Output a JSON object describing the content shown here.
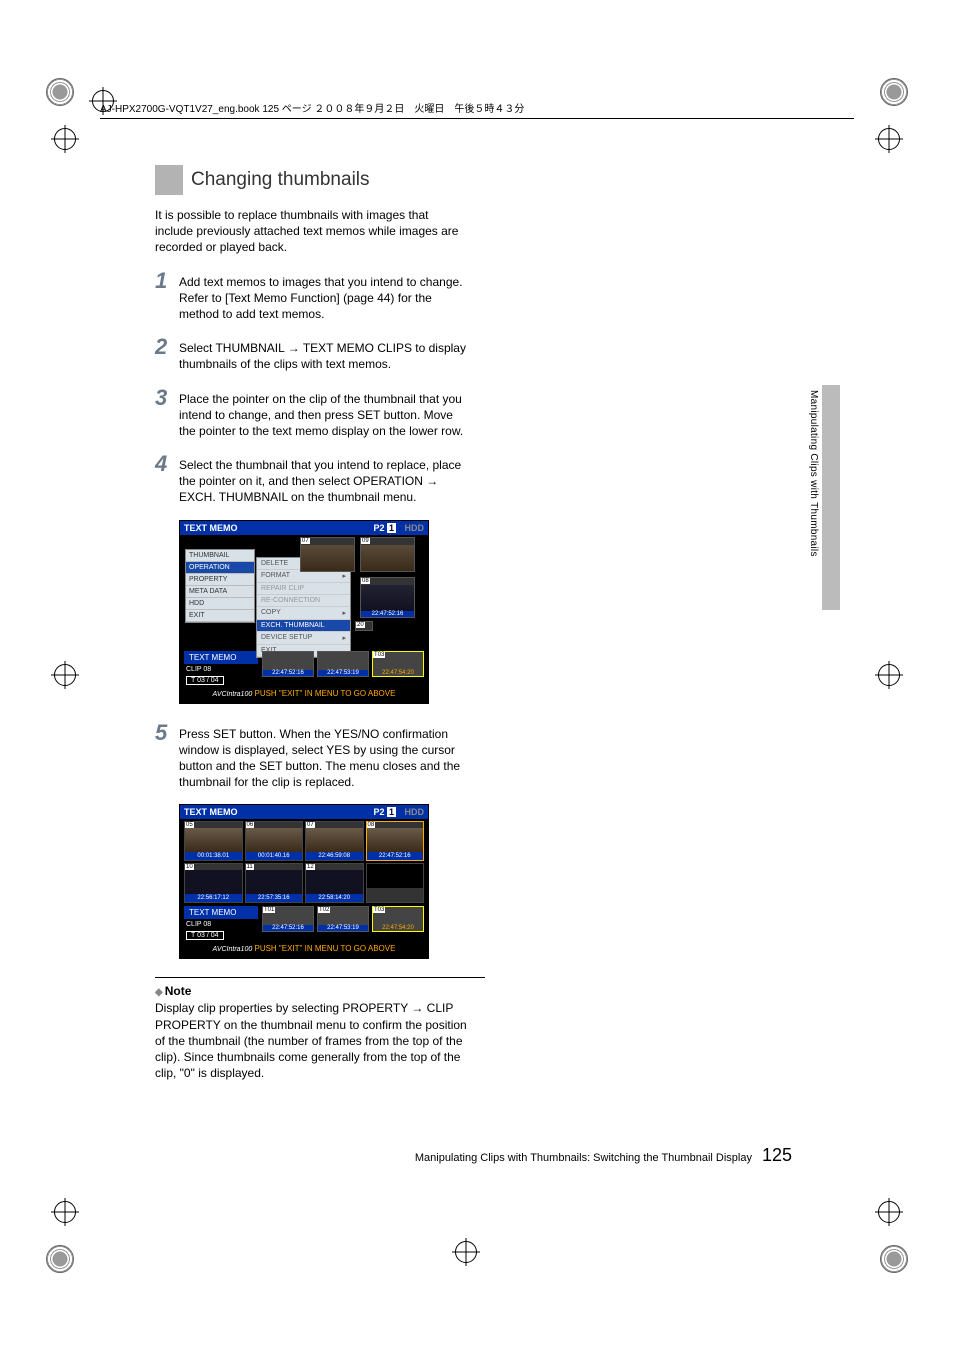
{
  "header_line": "AJ-HPX2700G-VQT1V27_eng.book  125 ページ  ２００８年９月２日　火曜日　午後５時４３分",
  "section_title": "Changing thumbnails",
  "intro": "It is possible to replace thumbnails with images that include previously attached text memos while images are recorded or played back.",
  "steps": {
    "s1": "Add text memos to images that you intend to change. Refer to [Text Memo Function] (page 44) for the method to add text memos.",
    "s2": "Select THUMBNAIL → TEXT MEMO CLIPS to display thumbnails of the clips with text memos.",
    "s3": "Place the pointer on the clip of the thumbnail that you intend to change, and then press SET button. Move the pointer to the text memo display on the lower row.",
    "s4": "Select the thumbnail that you intend to replace, place the pointer on it, and then select OPERATION → EXCH. THUMBNAIL on the thumbnail menu.",
    "s5": "Press SET button. When the YES/NO confirmation window is displayed, select YES by using the cursor button and the SET button. The menu closes and the thumbnail for the clip is replaced."
  },
  "screen1": {
    "title": "TEXT MEMO",
    "p2": "P2",
    "p2num": "1",
    "hdd": "HDD",
    "menu": {
      "m1": "THUMBNAIL",
      "m2": "OPERATION",
      "m3": "PROPERTY",
      "m4": "META DATA",
      "m5": "HDD",
      "m6": "EXIT"
    },
    "submenu": {
      "i1": "DELETE",
      "i2": "FORMAT",
      "i3": "REPAIR CLIP",
      "i4": "RE-CONNECTION",
      "i5": "COPY",
      "i6": "EXCH. THUMBNAIL",
      "i7": "DEVICE SETUP",
      "i8": "EXIT"
    },
    "clip_label": "TEXT MEMO",
    "clip_name": "CLIP 08",
    "clip_count": "T 03   /  04",
    "thumbs": {
      "n07": "07",
      "n08": "08",
      "n09": "09",
      "tc08": "22:47:52:16",
      "tc20": "20",
      "t03": "T03",
      "bt1": "22:47:52:16",
      "bt2": "22:47:53:19",
      "bt3": "22:47:54:20"
    },
    "footer_logo": "AVCIntra100",
    "footer_text": "PUSH \"EXIT\" IN MENU TO GO ABOVE"
  },
  "screen2": {
    "title": "TEXT MEMO",
    "p2": "P2",
    "p2num": "1",
    "hdd": "HDD",
    "clip_label": "TEXT MEMO",
    "clip_name": "CLIP 08",
    "clip_count": "T 03   /  04",
    "grid": {
      "n05": "05",
      "tc05": "00:01:38.01",
      "n06": "06",
      "tc06": "00:01:40.16",
      "n07": "07",
      "tc07": "22:46:59:08",
      "n08": "08",
      "tc08": "22:47:52:16",
      "n10": "10",
      "tc10": "22:56:17:12",
      "n11": "11",
      "tc11": "22:57:35:16",
      "n12": "12",
      "tc12": "22:58:14:20",
      "n13": "",
      "tc13": ""
    },
    "memos": {
      "t01": "T01",
      "t02": "T02",
      "t03": "T03",
      "bt1": "22:47:52:16",
      "bt2": "22:47:53:19",
      "bt3": "22:47:54:20"
    },
    "footer_logo": "AVCIntra100",
    "footer_text": "PUSH \"EXIT\" IN MENU TO GO ABOVE"
  },
  "note": {
    "heading": "Note",
    "body": "Display clip properties by selecting PROPERTY → CLIP PROPERTY on the thumbnail menu to confirm the position of the thumbnail (the number of frames from the top of the clip). Since thumbnails come generally from the top of the clip, \"0\" is displayed."
  },
  "side_tab": "Manipulating Clips with Thumbnails",
  "footer": {
    "text": "Manipulating Clips with Thumbnails: Switching the Thumbnail Display",
    "page": "125"
  }
}
